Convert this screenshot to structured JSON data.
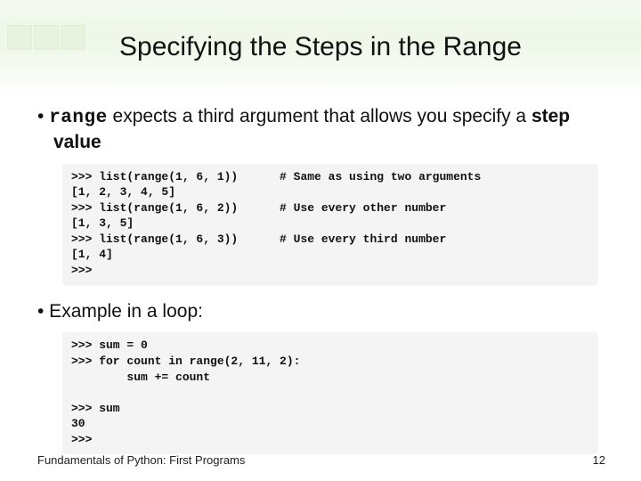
{
  "title": "Specifying the Steps in the Range",
  "bullets": {
    "b1_pre": "• ",
    "b1_code": "range",
    "b1_mid": " expects a third argument that allows you specify a ",
    "b1_bold": "step value",
    "b2": "•   Example in a loop:"
  },
  "code1": {
    "l1": ">>> list(range(1, 6, 1))      # Same as using two arguments",
    "l2": "[1, 2, 3, 4, 5]",
    "l3": ">>> list(range(1, 6, 2))      # Use every other number",
    "l4": "[1, 3, 5]",
    "l5": ">>> list(range(1, 6, 3))      # Use every third number",
    "l6": "[1, 4]",
    "l7": ">>>"
  },
  "code2": {
    "l1": ">>> sum = 0",
    "l2": ">>> for count in range(2, 11, 2):",
    "l3": "        sum += count",
    "l4": "",
    "l5": ">>> sum",
    "l6": "30",
    "l7": ">>>"
  },
  "footer": {
    "left": "Fundamentals of Python: First Programs",
    "right": "12"
  }
}
